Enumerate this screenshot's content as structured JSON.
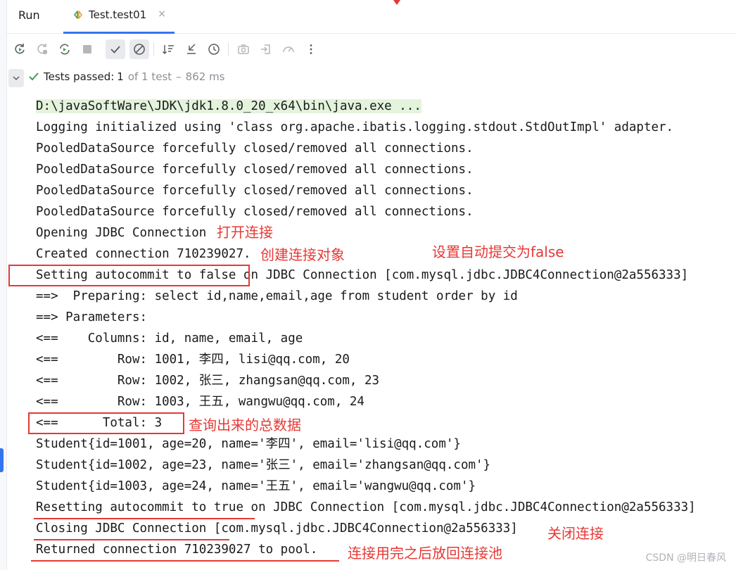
{
  "tabs": {
    "run_label": "Run",
    "test_label": "Test.test01",
    "close_glyph": "×"
  },
  "toolbar_icons": [
    "rerun-icon",
    "rerun-failed-icon",
    "toggle-auto-test-icon",
    "stop-icon",
    "show-passed-icon",
    "show-ignored-icon",
    "sort-icon",
    "collapse-all-icon",
    "history-icon",
    "screenshot-icon",
    "import-icon",
    "coverage-icon",
    "more-icon"
  ],
  "status": {
    "label": "Tests passed:",
    "passed": "1",
    "of_text": "of 1 test",
    "dash": "–",
    "duration": "862 ms"
  },
  "console_lines": [
    "D:\\javaSoftWare\\JDK\\jdk1.8.0_20_x64\\bin\\java.exe ...",
    "Logging initialized using 'class org.apache.ibatis.logging.stdout.StdOutImpl' adapter.",
    "PooledDataSource forcefully closed/removed all connections.",
    "PooledDataSource forcefully closed/removed all connections.",
    "PooledDataSource forcefully closed/removed all connections.",
    "PooledDataSource forcefully closed/removed all connections.",
    "Opening JDBC Connection",
    "Created connection 710239027.",
    "Setting autocommit to false on JDBC Connection [com.mysql.jdbc.JDBC4Connection@2a556333]",
    "==>  Preparing: select id,name,email,age from student order by id",
    "==> Parameters: ",
    "<==    Columns: id, name, email, age",
    "<==        Row: 1001, 李四, lisi@qq.com, 20",
    "<==        Row: 1002, 张三, zhangsan@qq.com, 23",
    "<==        Row: 1003, 王五, wangwu@qq.com, 24",
    "<==      Total: 3",
    "Student{id=1001, age=20, name='李四', email='lisi@qq.com'}",
    "Student{id=1002, age=23, name='张三', email='zhangsan@qq.com'}",
    "Student{id=1003, age=24, name='王五', email='wangwu@qq.com'}",
    "Resetting autocommit to true on JDBC Connection [com.mysql.jdbc.JDBC4Connection@2a556333]",
    "Closing JDBC Connection [com.mysql.jdbc.JDBC4Connection@2a556333]",
    "Returned connection 710239027 to pool."
  ],
  "annotations": {
    "open_connection": "打开连接",
    "create_object": "创建连接对象",
    "set_autocommit": "设置自动提交为false",
    "total_data": "查询出来的总数据",
    "close_connection": "关闭连接",
    "return_pool": "连接用完之后放回连接池"
  },
  "colors": {
    "annotation": "#e53935",
    "accent": "#3574f0",
    "pass": "#3f9e4a",
    "first_line_bg": "#e4f3dc"
  },
  "watermark": "CSDN @明日春风"
}
